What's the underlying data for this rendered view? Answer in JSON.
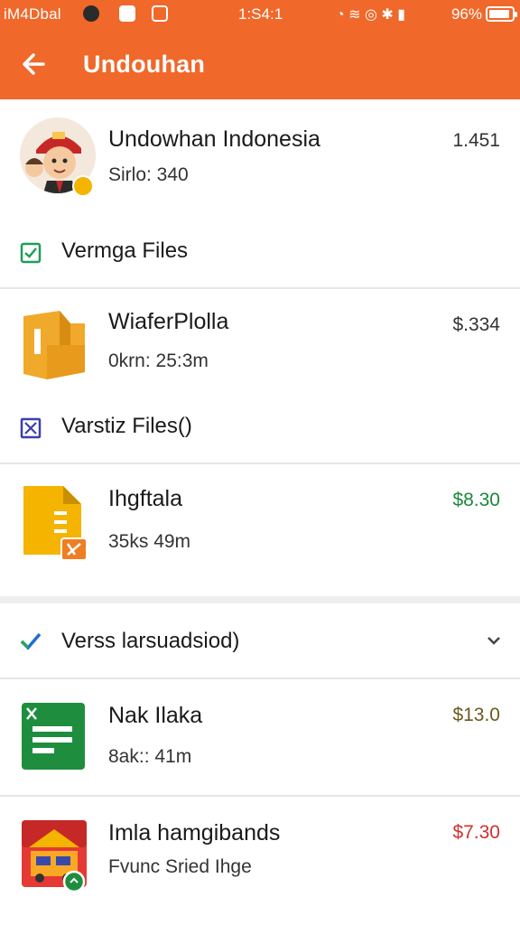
{
  "status_bar": {
    "carrier": "iM4Dbal",
    "time": "1:S4:1",
    "battery": "96%"
  },
  "app_bar": {
    "title": "Undouhan"
  },
  "profile": {
    "name": "Undowhan Indonesia",
    "meta": "Sirlo: 340",
    "value": "1.451"
  },
  "sections": [
    {
      "label": "Vermga Files",
      "icon": "check-box-icon",
      "color": "#1e9e5a"
    },
    {
      "label": "Varstiz Files()",
      "icon": "cross-box-icon",
      "color": "#3b3fb0"
    },
    {
      "label": "Verss larsuadsiod)",
      "icon": "checkmark-icon",
      "color": "#1f6fd1"
    }
  ],
  "items": [
    {
      "name": "WiaferPlolla",
      "meta": "0krn: 25:3m",
      "price": "$.334",
      "price_color": "#333333",
      "icon": "folder-icon"
    },
    {
      "name": "Ihgftala",
      "meta": "35ks 49m",
      "price": "$8.30",
      "price_color": "#1a8a3a",
      "icon": "document-icon"
    },
    {
      "name": "Nak Ilaka",
      "meta": "8ak:: 41m",
      "price": "$13.0",
      "price_color": "#6b5a1e",
      "icon": "spreadsheet-icon"
    },
    {
      "name": "Imla hamgibands",
      "meta": "Fvunc Sried Ihge",
      "price": "$7.30",
      "price_color": "#d32f2f",
      "icon": "app-thumbnail-icon"
    }
  ]
}
